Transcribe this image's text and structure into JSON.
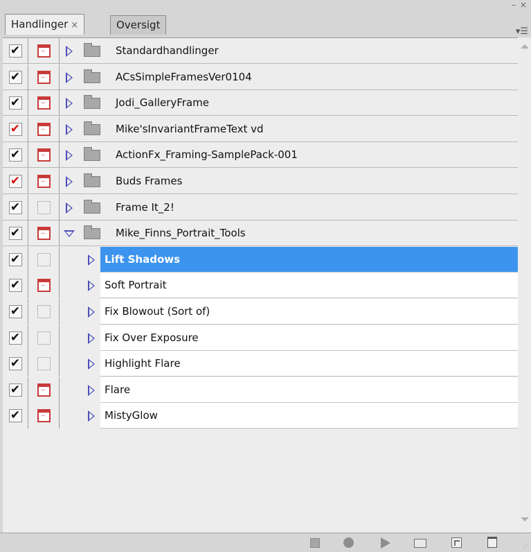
{
  "window": {
    "minimize_glyph": "–",
    "close_glyph": "×"
  },
  "tabs": [
    {
      "label": "Handlinger",
      "close": "×",
      "active": true
    },
    {
      "label": "Oversigt",
      "active": false
    }
  ],
  "panel_menu_icon": "panel-menu-icon",
  "sets": [
    {
      "label": "Standardhandlinger",
      "check": "✔",
      "check_red": false,
      "dialog": true,
      "expanded": false
    },
    {
      "label": "ACsSimpleFramesVer0104",
      "check": "✔",
      "check_red": false,
      "dialog": true,
      "expanded": false
    },
    {
      "label": "Jodi_GalleryFrame",
      "check": "✔",
      "check_red": false,
      "dialog": true,
      "expanded": false
    },
    {
      "label": "Mike'sInvariantFrameText vd",
      "check": "✔",
      "check_red": true,
      "dialog": true,
      "expanded": false
    },
    {
      "label": "ActionFx_Framing-SamplePack-001",
      "check": "✔",
      "check_red": false,
      "dialog": true,
      "expanded": false
    },
    {
      "label": "Buds Frames",
      "check": "✔",
      "check_red": true,
      "dialog": true,
      "expanded": false
    },
    {
      "label": "Frame It_2!",
      "check": "✔",
      "check_red": false,
      "dialog": false,
      "expanded": false
    },
    {
      "label": "Mike_Finns_Portrait_Tools",
      "check": "✔",
      "check_red": false,
      "dialog": true,
      "expanded": true
    }
  ],
  "actions": [
    {
      "label": "Lift Shadows",
      "check": "✔",
      "dialog": false,
      "selected": true
    },
    {
      "label": "Soft Portrait",
      "check": "✔",
      "dialog": true,
      "selected": false
    },
    {
      "label": "Fix Blowout (Sort of)",
      "check": "✔",
      "dialog": false,
      "selected": false
    },
    {
      "label": "Fix Over Exposure",
      "check": "✔",
      "dialog": false,
      "selected": false
    },
    {
      "label": "Highlight Flare",
      "check": "✔",
      "dialog": false,
      "selected": false
    },
    {
      "label": "Flare",
      "check": "✔",
      "dialog": true,
      "selected": false
    },
    {
      "label": "MistyGlow",
      "check": "✔",
      "dialog": true,
      "selected": false
    }
  ],
  "toolbar": [
    "stop-icon",
    "record-icon",
    "play-icon",
    "new-set-icon",
    "new-action-icon",
    "delete-icon"
  ],
  "colors": {
    "selection": "#3d94ee",
    "dialog_red": "#c83a3a",
    "triangle": "#4b4db8",
    "check_red": "#dd1111"
  }
}
